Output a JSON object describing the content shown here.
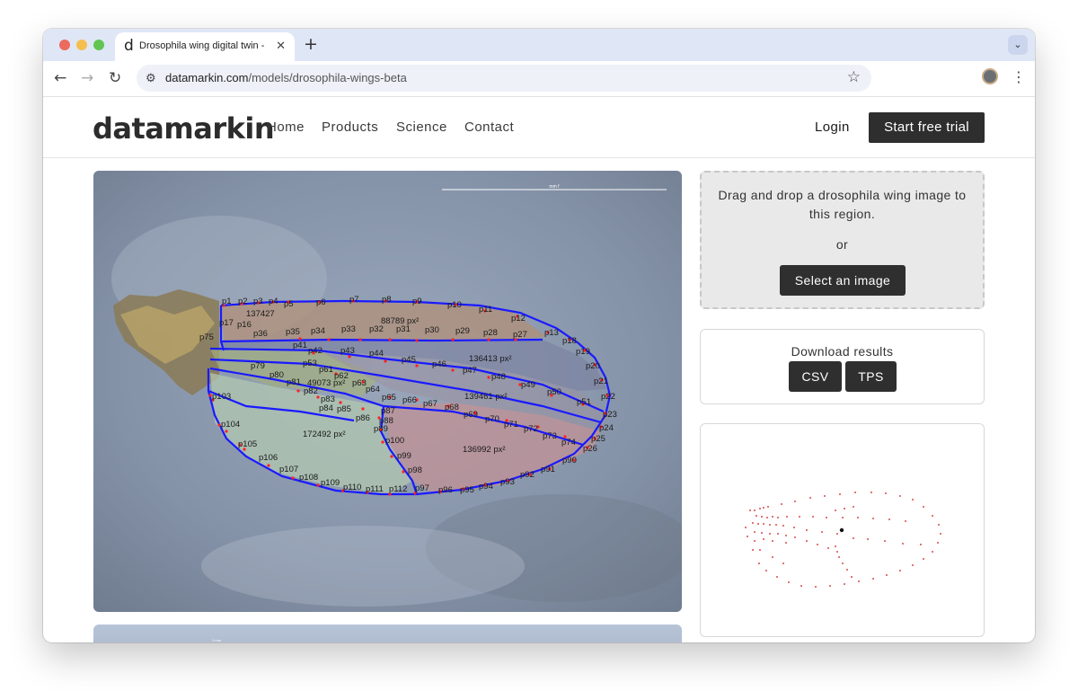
{
  "browser": {
    "tab_title": "Drosophila wing digital twin -",
    "tab_favicon": "d",
    "url_domain": "datamarkin.com",
    "url_path": "/models/drosophila-wings-beta"
  },
  "header": {
    "logo": "datamarkin",
    "nav": [
      "Home",
      "Products",
      "Science",
      "Contact"
    ],
    "login": "Login",
    "cta": "Start free trial"
  },
  "main_image": {
    "scale_label": "mm f",
    "scale_label_2": "1 mm",
    "area_labels": [
      "137427",
      "88789 px²",
      "136413 px²",
      "49073 px²",
      "139461 px²",
      "172492 px²",
      "136992 px²"
    ],
    "point_labels": [
      "p1",
      "p2",
      "p3",
      "p4",
      "p5",
      "p6",
      "p7",
      "p8",
      "p9",
      "p10",
      "p11",
      "p12",
      "p13",
      "p18",
      "p19",
      "p20",
      "p21",
      "p22",
      "p23",
      "p24",
      "p25",
      "p26",
      "p90",
      "p91",
      "p92",
      "p93",
      "p94",
      "p95",
      "p96",
      "p97",
      "p98",
      "p99",
      "p100",
      "p88",
      "p87",
      "p89",
      "p86",
      "p85",
      "p84",
      "p83",
      "p82",
      "p81",
      "p80",
      "p79",
      "p35",
      "p34",
      "p33",
      "p32",
      "p31",
      "p30",
      "p29",
      "p28",
      "p27",
      "p42",
      "p43",
      "p44",
      "p45",
      "p46",
      "p47",
      "p48",
      "p49",
      "p50",
      "p51",
      "p61",
      "p62",
      "p63",
      "p64",
      "p65",
      "p66",
      "p67",
      "p68",
      "p69",
      "p70",
      "p71",
      "p72",
      "p73",
      "p74",
      "p103",
      "p104",
      "p105",
      "p106",
      "p107",
      "p108",
      "p109",
      "p110",
      "p111",
      "p112",
      "p17",
      "p16",
      "p75",
      "p53",
      "p36",
      "p41"
    ]
  },
  "dropzone": {
    "text": "Drag and drop a drosophila wing image to this region.",
    "or": "or",
    "button": "Select an image"
  },
  "download": {
    "title": "Download results",
    "csv": "CSV",
    "tps": "TPS"
  },
  "icons": {
    "back": "back-arrow-icon",
    "forward": "forward-arrow-icon",
    "reload": "reload-icon",
    "site_settings": "tune-icon",
    "bookmark": "star-icon",
    "menu": "kebab-icon"
  }
}
